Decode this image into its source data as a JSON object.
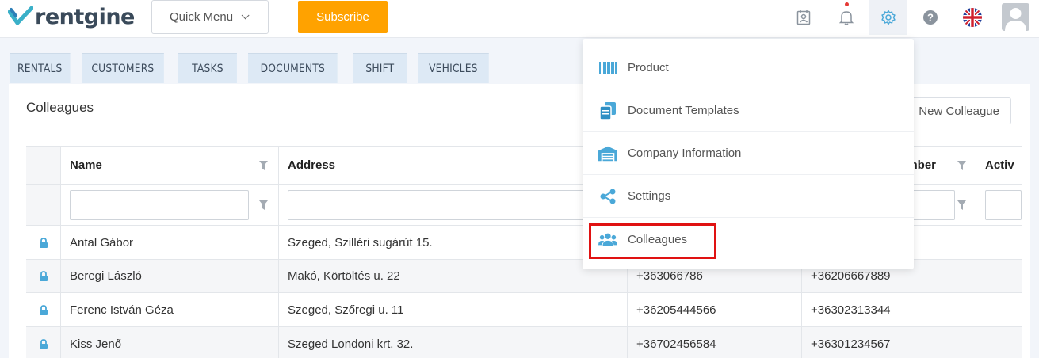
{
  "app": {
    "brand": "rentgine"
  },
  "header": {
    "quick_menu_label": "Quick Menu",
    "subscribe_label": "Subscribe"
  },
  "tabs": [
    "RENTALS",
    "CUSTOMERS",
    "TASKS",
    "DOCUMENTS",
    "SHIFT",
    "VEHICLES"
  ],
  "page": {
    "title": "Colleagues",
    "new_button_label": "New Colleague"
  },
  "table": {
    "columns": [
      "Name",
      "Address",
      "",
      "mber",
      "Activ"
    ],
    "rows": [
      {
        "name": "Antal Gábor",
        "address": "Szeged, Szilléri sugárút 15.",
        "phone1": "",
        "phone2": ""
      },
      {
        "name": "Beregi László",
        "address": "Makó, Körtöltés u. 22",
        "phone1": "+363066786",
        "phone2": "+36206667889"
      },
      {
        "name": "Ferenc István Géza",
        "address": "Szeged, Szőregi u. 11",
        "phone1": "+36205444566",
        "phone2": "+36302313344"
      },
      {
        "name": "Kiss Jenő",
        "address": "Szeged Londoni krt. 32.",
        "phone1": "+36702456584",
        "phone2": "+36301234567"
      }
    ]
  },
  "settings_menu": {
    "items": [
      {
        "label": "Product",
        "icon": "barcode-icon"
      },
      {
        "label": "Document Templates",
        "icon": "documents-icon"
      },
      {
        "label": "Company Information",
        "icon": "warehouse-icon"
      },
      {
        "label": "Settings",
        "icon": "share-icon"
      },
      {
        "label": "Colleagues",
        "icon": "users-icon"
      }
    ],
    "highlighted": "Colleagues"
  },
  "colors": {
    "accent": "#4aa8d8",
    "subscribe": "#ffa200",
    "highlight": "#e01212",
    "tab_bg": "#dde9f5"
  }
}
